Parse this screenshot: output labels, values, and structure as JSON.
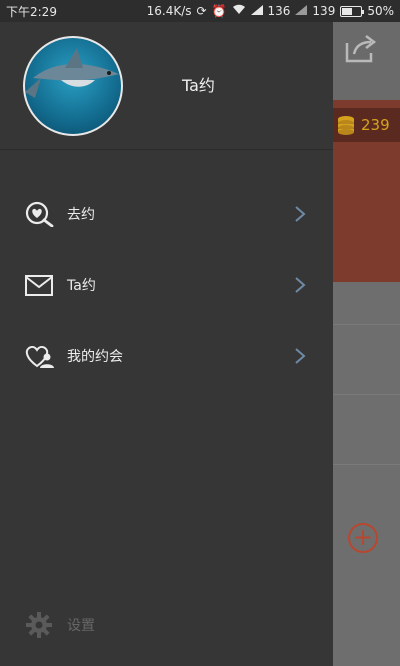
{
  "status_bar": {
    "time": "下午2:29",
    "network_speed": "16.4K/s",
    "signal1": "136",
    "signal2": "139",
    "battery": "50%",
    "battery_level": 0.5
  },
  "drawer": {
    "profile_name": "Ta约",
    "menu": [
      {
        "label": "去约",
        "icon": "search-heart-icon"
      },
      {
        "label": "Ta约",
        "icon": "envelope-icon"
      },
      {
        "label": "我的约会",
        "icon": "heart-person-icon"
      }
    ],
    "settings_label": "设置"
  },
  "background_app": {
    "coin_count": "239"
  },
  "colors": {
    "drawer_bg": "#363636",
    "accent_red": "#b8472f",
    "coin_gold": "#d6a21e",
    "chevron": "#6f8aa6"
  }
}
